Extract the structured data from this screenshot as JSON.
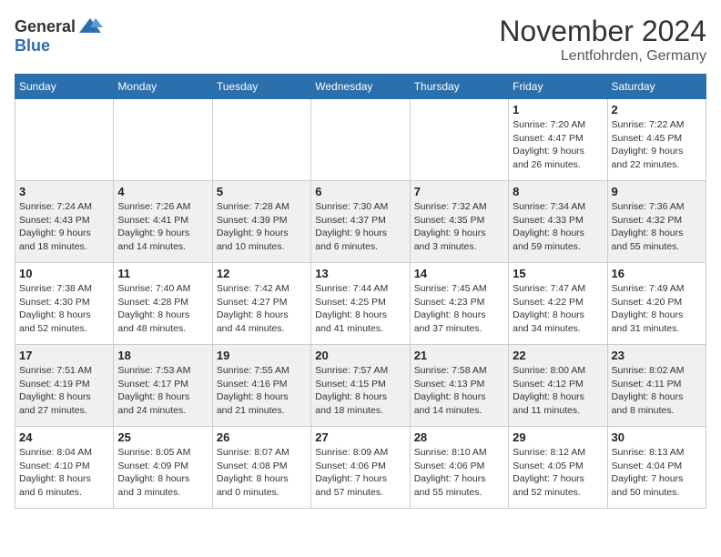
{
  "header": {
    "logo_line1": "General",
    "logo_line2": "Blue",
    "month_title": "November 2024",
    "location": "Lentfohrden, Germany"
  },
  "weekdays": [
    "Sunday",
    "Monday",
    "Tuesday",
    "Wednesday",
    "Thursday",
    "Friday",
    "Saturday"
  ],
  "weeks": [
    [
      {
        "day": "",
        "info": ""
      },
      {
        "day": "",
        "info": ""
      },
      {
        "day": "",
        "info": ""
      },
      {
        "day": "",
        "info": ""
      },
      {
        "day": "",
        "info": ""
      },
      {
        "day": "1",
        "info": "Sunrise: 7:20 AM\nSunset: 4:47 PM\nDaylight: 9 hours\nand 26 minutes."
      },
      {
        "day": "2",
        "info": "Sunrise: 7:22 AM\nSunset: 4:45 PM\nDaylight: 9 hours\nand 22 minutes."
      }
    ],
    [
      {
        "day": "3",
        "info": "Sunrise: 7:24 AM\nSunset: 4:43 PM\nDaylight: 9 hours\nand 18 minutes."
      },
      {
        "day": "4",
        "info": "Sunrise: 7:26 AM\nSunset: 4:41 PM\nDaylight: 9 hours\nand 14 minutes."
      },
      {
        "day": "5",
        "info": "Sunrise: 7:28 AM\nSunset: 4:39 PM\nDaylight: 9 hours\nand 10 minutes."
      },
      {
        "day": "6",
        "info": "Sunrise: 7:30 AM\nSunset: 4:37 PM\nDaylight: 9 hours\nand 6 minutes."
      },
      {
        "day": "7",
        "info": "Sunrise: 7:32 AM\nSunset: 4:35 PM\nDaylight: 9 hours\nand 3 minutes."
      },
      {
        "day": "8",
        "info": "Sunrise: 7:34 AM\nSunset: 4:33 PM\nDaylight: 8 hours\nand 59 minutes."
      },
      {
        "day": "9",
        "info": "Sunrise: 7:36 AM\nSunset: 4:32 PM\nDaylight: 8 hours\nand 55 minutes."
      }
    ],
    [
      {
        "day": "10",
        "info": "Sunrise: 7:38 AM\nSunset: 4:30 PM\nDaylight: 8 hours\nand 52 minutes."
      },
      {
        "day": "11",
        "info": "Sunrise: 7:40 AM\nSunset: 4:28 PM\nDaylight: 8 hours\nand 48 minutes."
      },
      {
        "day": "12",
        "info": "Sunrise: 7:42 AM\nSunset: 4:27 PM\nDaylight: 8 hours\nand 44 minutes."
      },
      {
        "day": "13",
        "info": "Sunrise: 7:44 AM\nSunset: 4:25 PM\nDaylight: 8 hours\nand 41 minutes."
      },
      {
        "day": "14",
        "info": "Sunrise: 7:45 AM\nSunset: 4:23 PM\nDaylight: 8 hours\nand 37 minutes."
      },
      {
        "day": "15",
        "info": "Sunrise: 7:47 AM\nSunset: 4:22 PM\nDaylight: 8 hours\nand 34 minutes."
      },
      {
        "day": "16",
        "info": "Sunrise: 7:49 AM\nSunset: 4:20 PM\nDaylight: 8 hours\nand 31 minutes."
      }
    ],
    [
      {
        "day": "17",
        "info": "Sunrise: 7:51 AM\nSunset: 4:19 PM\nDaylight: 8 hours\nand 27 minutes."
      },
      {
        "day": "18",
        "info": "Sunrise: 7:53 AM\nSunset: 4:17 PM\nDaylight: 8 hours\nand 24 minutes."
      },
      {
        "day": "19",
        "info": "Sunrise: 7:55 AM\nSunset: 4:16 PM\nDaylight: 8 hours\nand 21 minutes."
      },
      {
        "day": "20",
        "info": "Sunrise: 7:57 AM\nSunset: 4:15 PM\nDaylight: 8 hours\nand 18 minutes."
      },
      {
        "day": "21",
        "info": "Sunrise: 7:58 AM\nSunset: 4:13 PM\nDaylight: 8 hours\nand 14 minutes."
      },
      {
        "day": "22",
        "info": "Sunrise: 8:00 AM\nSunset: 4:12 PM\nDaylight: 8 hours\nand 11 minutes."
      },
      {
        "day": "23",
        "info": "Sunrise: 8:02 AM\nSunset: 4:11 PM\nDaylight: 8 hours\nand 8 minutes."
      }
    ],
    [
      {
        "day": "24",
        "info": "Sunrise: 8:04 AM\nSunset: 4:10 PM\nDaylight: 8 hours\nand 6 minutes."
      },
      {
        "day": "25",
        "info": "Sunrise: 8:05 AM\nSunset: 4:09 PM\nDaylight: 8 hours\nand 3 minutes."
      },
      {
        "day": "26",
        "info": "Sunrise: 8:07 AM\nSunset: 4:08 PM\nDaylight: 8 hours\nand 0 minutes."
      },
      {
        "day": "27",
        "info": "Sunrise: 8:09 AM\nSunset: 4:06 PM\nDaylight: 7 hours\nand 57 minutes."
      },
      {
        "day": "28",
        "info": "Sunrise: 8:10 AM\nSunset: 4:06 PM\nDaylight: 7 hours\nand 55 minutes."
      },
      {
        "day": "29",
        "info": "Sunrise: 8:12 AM\nSunset: 4:05 PM\nDaylight: 7 hours\nand 52 minutes."
      },
      {
        "day": "30",
        "info": "Sunrise: 8:13 AM\nSunset: 4:04 PM\nDaylight: 7 hours\nand 50 minutes."
      }
    ]
  ]
}
